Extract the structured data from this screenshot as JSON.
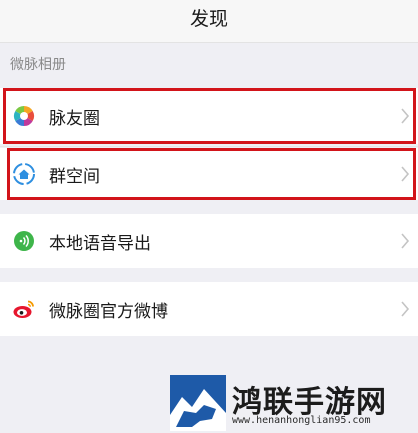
{
  "header": {
    "title": "发现"
  },
  "section": {
    "label": "微脉相册"
  },
  "items": [
    {
      "label": "脉友圈",
      "icon": "pinwheel-icon"
    },
    {
      "label": "群空间",
      "icon": "home-sync-icon"
    },
    {
      "label": "本地语音导出",
      "icon": "voice-export-icon"
    },
    {
      "label": "微脉圈官方微博",
      "icon": "weibo-icon"
    }
  ],
  "watermark": {
    "title": "鸿联手游网",
    "url": "www.henanhonglian95.com"
  },
  "colors": {
    "highlight": "#d2141a",
    "background": "#efeff4"
  }
}
